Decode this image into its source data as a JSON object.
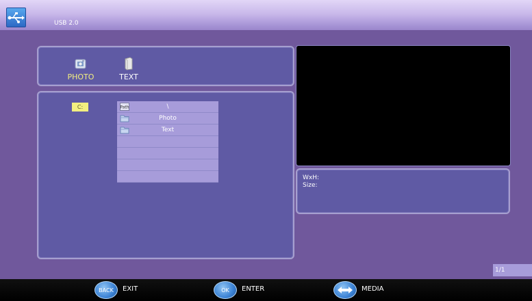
{
  "header": {
    "title": "USB 2.0",
    "logo_icon": "usb-icon"
  },
  "media_types": [
    {
      "label": "PHOTO",
      "icon": "photo-icon",
      "selected": true,
      "color": "#f3ef80"
    },
    {
      "label": "TEXT",
      "icon": "text-file-icon",
      "selected": false,
      "color": "#ffffff"
    }
  ],
  "drive": {
    "label": "C:"
  },
  "file_list": [
    {
      "name": "\\",
      "icon": "path-icon"
    },
    {
      "name": "Photo",
      "icon": "folder-icon"
    },
    {
      "name": "Text",
      "icon": "folder-icon"
    },
    {
      "name": ""
    },
    {
      "name": ""
    },
    {
      "name": ""
    },
    {
      "name": ""
    }
  ],
  "info": {
    "dimensions_label": "WxH:",
    "size_label": "Size:"
  },
  "pagination": {
    "text": "1/1"
  },
  "bottom_bar": [
    {
      "button_text": "BACK",
      "label": "EXIT",
      "icon": "back-button-icon"
    },
    {
      "button_text": "OK",
      "label": "ENTER",
      "icon": "ok-button-icon"
    },
    {
      "button_text": "",
      "label": "MEDIA",
      "icon": "left-right-arrows-icon"
    }
  ],
  "colors": {
    "background": "#70589c",
    "panel": "#5f5aa4",
    "list_row": "#a79cda",
    "highlight": "#f3ef80"
  }
}
